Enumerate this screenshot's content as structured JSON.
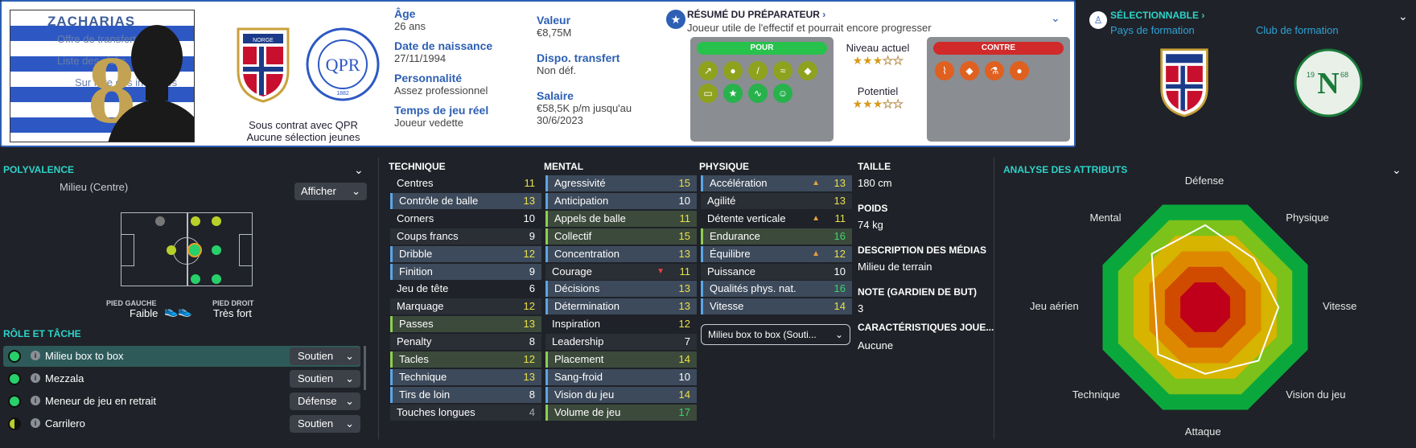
{
  "player": {
    "name": "ZACHARIAS",
    "ghost_lines": [
      "Offre de transfert",
      "Liste des clubs",
      "Sur liste des indésirés"
    ],
    "shirt_number": "8"
  },
  "contract": {
    "line1": "Sous contrat avec QPR",
    "line2": "Aucune sélection jeunes"
  },
  "crests": {
    "norway": "NORGE",
    "qpr": "QUEENS PARK RANGERS",
    "qpr_init": "QPR",
    "qpr_year": "1882",
    "club": "N",
    "club_years": [
      "19",
      "68"
    ]
  },
  "info": {
    "age_label": "Âge",
    "age": "26 ans",
    "dob_label": "Date de naissance",
    "dob": "27/11/1994",
    "pers_label": "Personnalité",
    "pers": "Assez professionnel",
    "time_label": "Temps de jeu réel",
    "time": "Joueur vedette",
    "value_label": "Valeur",
    "value": "€8,75M",
    "transfer_label": "Dispo. transfert",
    "transfer": "Non déf.",
    "salary_label": "Salaire",
    "salary": "€58,5K p/m jusqu'au 30/6/2023"
  },
  "report": {
    "title": "RÉSUMÉ DU PRÉPARATEUR",
    "subtitle": "Joueur utile de l'effectif et pourrait encore progresser",
    "pour": "POUR",
    "contre": "CONTRE",
    "niveau": "Niveau actuel",
    "potentiel": "Potentiel",
    "niveau_stars": 3,
    "potentiel_stars": 3
  },
  "selection": {
    "title": "SÉLECTIONNABLE",
    "country": "Pays de formation",
    "club": "Club de formation"
  },
  "poly": {
    "title": "POLYVALENCE",
    "position": "Milieu (Centre)",
    "show": "Afficher",
    "left_foot_label": "PIED GAUCHE",
    "left_foot": "Faible",
    "right_foot_label": "PIED DROIT",
    "right_foot": "Très fort"
  },
  "roles": {
    "title": "RÔLE ET TÂCHE",
    "items": [
      {
        "name": "Milieu box to box",
        "duty": "Soutien"
      },
      {
        "name": "Mezzala",
        "duty": "Soutien"
      },
      {
        "name": "Meneur de jeu en retrait",
        "duty": "Défense"
      },
      {
        "name": "Carrilero",
        "duty": "Soutien"
      }
    ]
  },
  "technique": {
    "title": "TECHNIQUE",
    "items": [
      [
        "Centres",
        "11"
      ],
      [
        "Contrôle de balle",
        "13"
      ],
      [
        "Corners",
        "10"
      ],
      [
        "Coups francs",
        "9"
      ],
      [
        "Dribble",
        "12"
      ],
      [
        "Finition",
        "9"
      ],
      [
        "Jeu de tête",
        "6"
      ],
      [
        "Marquage",
        "12"
      ],
      [
        "Passes",
        "13"
      ],
      [
        "Penalty",
        "8"
      ],
      [
        "Tacles",
        "12"
      ],
      [
        "Technique",
        "13"
      ],
      [
        "Tirs de loin",
        "8"
      ],
      [
        "Touches longues",
        "4"
      ]
    ]
  },
  "mental": {
    "title": "MENTAL",
    "items": [
      [
        "Agressivité",
        "15"
      ],
      [
        "Anticipation",
        "10"
      ],
      [
        "Appels de balle",
        "11"
      ],
      [
        "Collectif",
        "15"
      ],
      [
        "Concentration",
        "13"
      ],
      [
        "Courage",
        "11"
      ],
      [
        "Décisions",
        "13"
      ],
      [
        "Détermination",
        "13"
      ],
      [
        "Inspiration",
        "12"
      ],
      [
        "Leadership",
        "7"
      ],
      [
        "Placement",
        "14"
      ],
      [
        "Sang-froid",
        "10"
      ],
      [
        "Vision du jeu",
        "14"
      ],
      [
        "Volume de jeu",
        "17"
      ]
    ]
  },
  "physique": {
    "title": "PHYSIQUE",
    "items": [
      [
        "Accélération",
        "13"
      ],
      [
        "Agilité",
        "13"
      ],
      [
        "Détente verticale",
        "11"
      ],
      [
        "Endurance",
        "16"
      ],
      [
        "Équilibre",
        "12"
      ],
      [
        "Puissance",
        "10"
      ],
      [
        "Qualités phys. nat.",
        "16"
      ],
      [
        "Vitesse",
        "14"
      ]
    ],
    "role_select": "Milieu box to box (Souti..."
  },
  "details": {
    "taille_label": "TAILLE",
    "taille": "180 cm",
    "poids_label": "POIDS",
    "poids": "74 kg",
    "desc_label": "DESCRIPTION DES MÉDIAS",
    "desc": "Milieu de terrain",
    "note_label": "NOTE (GARDIEN DE BUT)",
    "note": "3",
    "car_label": "CARACTÉRISTIQUES JOUE...",
    "car": "Aucune"
  },
  "radar": {
    "title": "ANALYSE DES ATTRIBUTS",
    "axes": [
      "Défense",
      "Physique",
      "Vitesse",
      "Vision du jeu",
      "Attaque",
      "Technique",
      "Jeu aérien",
      "Mental"
    ],
    "values": [
      0.74,
      0.62,
      0.66,
      0.68,
      0.6,
      0.6,
      0.45,
      0.68
    ],
    "colors": [
      "#0aa83c",
      "#7cc21a",
      "#d6b400",
      "#de8800",
      "#d04a00",
      "#c0001a"
    ]
  }
}
